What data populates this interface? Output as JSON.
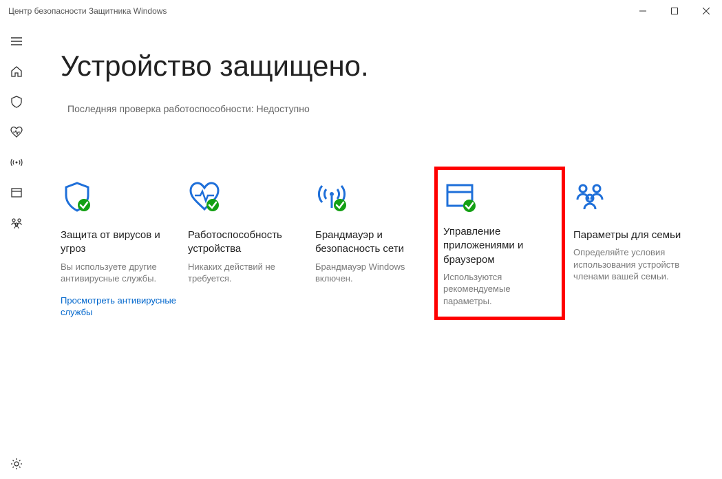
{
  "window": {
    "title": "Центр безопасности Защитника Windows"
  },
  "page": {
    "title": "Устройство защищено.",
    "subtitle": "Последняя проверка работоспособности: Недоступно"
  },
  "cards": [
    {
      "title": "Защита от вирусов и угроз",
      "desc": "Вы используете другие антивирусные службы.",
      "link": "Просмотреть антивирусные службы"
    },
    {
      "title": "Работоспособность устройства",
      "desc": "Никаких действий не требуется.",
      "link": ""
    },
    {
      "title": "Брандмауэр и безопасность сети",
      "desc": "Брандмауэр Windows включен.",
      "link": ""
    },
    {
      "title": "Управление приложениями и браузером",
      "desc": "Используются рекомендуемые параметры.",
      "link": ""
    },
    {
      "title": "Параметры для семьи",
      "desc": "Определяйте условия использования устройств членами вашей семьи.",
      "link": ""
    }
  ]
}
